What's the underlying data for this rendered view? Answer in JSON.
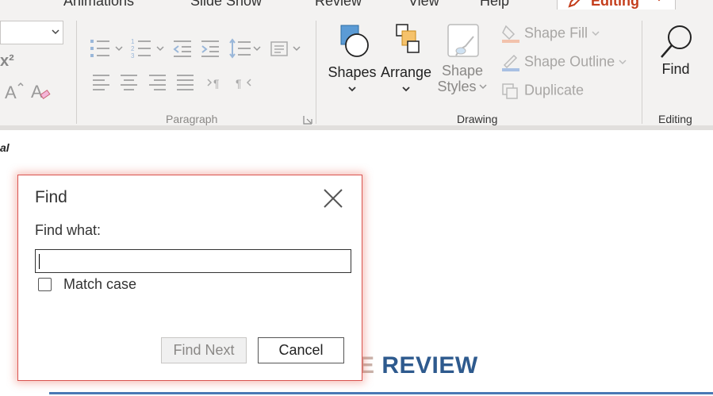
{
  "tabs": [
    {
      "label": "Animations"
    },
    {
      "label": "Slide Show"
    },
    {
      "label": "Review"
    },
    {
      "label": "View"
    },
    {
      "label": "Help"
    }
  ],
  "editing_button": {
    "label": "Editing"
  },
  "ribbon": {
    "font_group": {
      "superscript_label": "x²"
    },
    "paragraph": {
      "label": "Paragraph"
    },
    "drawing": {
      "label": "Drawing",
      "shapes_label": "Shapes",
      "arrange_label": "Arrange",
      "shape_styles_line1": "Shape",
      "shape_styles_line2": "Styles",
      "shape_fill_label": "Shape Fill",
      "shape_outline_label": "Shape Outline",
      "duplicate_label": "Duplicate"
    },
    "editing": {
      "label": "Editing",
      "find_label": "Find"
    }
  },
  "document": {
    "cut_text": "al",
    "heading_prefix": "E",
    "heading_text": " REVIEW"
  },
  "dialog": {
    "title": "Find",
    "find_what_label": "Find what:",
    "find_value": "",
    "match_case_label": "Match case",
    "match_case_checked": false,
    "find_next_label": "Find Next",
    "cancel_label": "Cancel"
  },
  "colors": {
    "accent_red": "#c43e1c",
    "dialog_border": "#d9534f",
    "heading_blue": "#2e5a8e",
    "ribbon_bg": "#f3f2f1"
  }
}
